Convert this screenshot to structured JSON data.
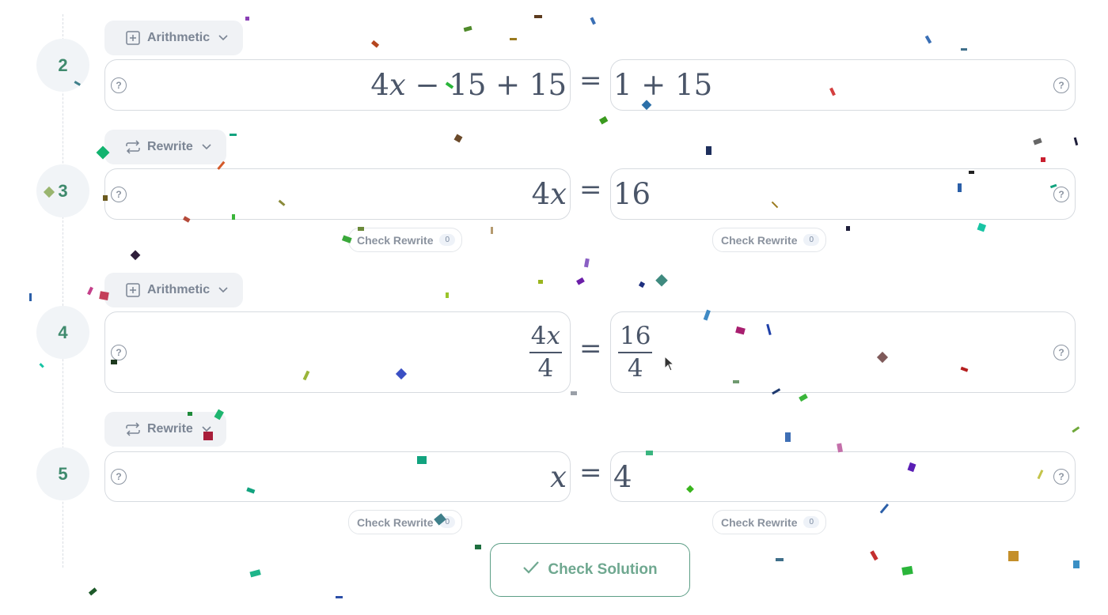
{
  "colors": {
    "accent_green": "#3f8a6d",
    "button_border": "#5c9e86",
    "chip_bg": "#f0f2f5",
    "text": "#4a5568"
  },
  "steps": [
    {
      "number": "2",
      "operation": {
        "label": "Arithmetic",
        "icon": "plus-box-icon"
      },
      "lhs": [
        "4",
        "x",
        " − 15 + 15"
      ],
      "rhs": [
        "1 + 15"
      ]
    },
    {
      "number": "3",
      "operation": {
        "label": "Rewrite",
        "icon": "repeat-icon"
      },
      "lhs": [
        "4",
        "x"
      ],
      "rhs": [
        "16"
      ],
      "check_lhs": {
        "label": "Check Rewrite",
        "count": "0"
      },
      "check_rhs": {
        "label": "Check Rewrite",
        "count": "0"
      }
    },
    {
      "number": "4",
      "operation": {
        "label": "Arithmetic",
        "icon": "plus-box-icon"
      },
      "lhs_frac": {
        "num": [
          "4",
          "x"
        ],
        "den": "4"
      },
      "rhs_frac": {
        "num": "16",
        "den": "4"
      }
    },
    {
      "number": "5",
      "operation": {
        "label": "Rewrite",
        "icon": "repeat-icon"
      },
      "lhs": [
        "x"
      ],
      "rhs": [
        "4"
      ],
      "check_lhs": {
        "label": "Check Rewrite",
        "count": "0"
      },
      "check_rhs": {
        "label": "Check Rewrite",
        "count": "0"
      }
    }
  ],
  "equals_sign": "=",
  "help_glyph": "?",
  "check_solution": {
    "label": "Check Solution",
    "icon": "checkmark-icon"
  }
}
